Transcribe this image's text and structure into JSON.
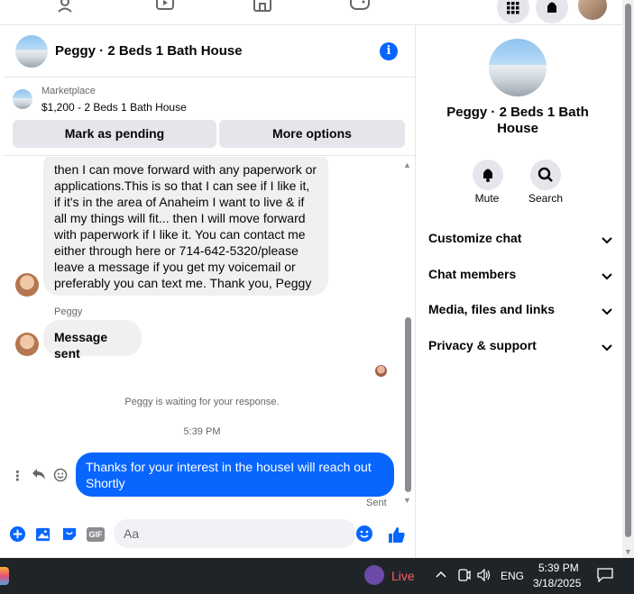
{
  "colors": {
    "accent": "#0866ff",
    "bubble_gray": "#f0f0f0",
    "muted": "#65676b"
  },
  "topnav": {
    "icons": [
      "groups-icon",
      "watch-icon",
      "marketplace-icon",
      "gaming-icon"
    ],
    "right_icons": [
      "menu-grid-icon",
      "notifications-icon",
      "account-avatar"
    ]
  },
  "chat": {
    "header_title": "Peggy · 2 Beds 1 Bath House",
    "marketplace_label": "Marketplace",
    "listing": "$1,200 - 2 Beds 1 Bath House",
    "mark_pending": "Mark as pending",
    "more_options": "More options",
    "messages": [
      {
        "text": "then I can move forward with any paperwork or applications.This is so that I can see if I like it, if it's in the area of Anaheim I want to live & if all my things will fit... then I will move forward with paperwork if I like it. You can contact me either through here or 714-642-5320/please leave a message if you get my voicemail or preferably you can text me. Thank you, Peggy"
      },
      {
        "sender": "Peggy",
        "text": "Message sent"
      }
    ],
    "waiting": "Peggy is waiting for your response.",
    "timestamp": "5:39 PM",
    "my_message": "Thanks for your interest in the houseI will reach out Shortly",
    "sent_status": "Sent",
    "composer_placeholder": "Aa",
    "gif_label": "GIF"
  },
  "right_panel": {
    "name": "Peggy · 2 Beds 1 Bath House",
    "mute": "Mute",
    "search": "Search",
    "sections": [
      "Customize chat",
      "Chat members",
      "Media, files and links",
      "Privacy & support"
    ]
  },
  "taskbar": {
    "live": "Live",
    "lang": "ENG",
    "time": "5:39 PM",
    "date": "3/18/2025"
  }
}
